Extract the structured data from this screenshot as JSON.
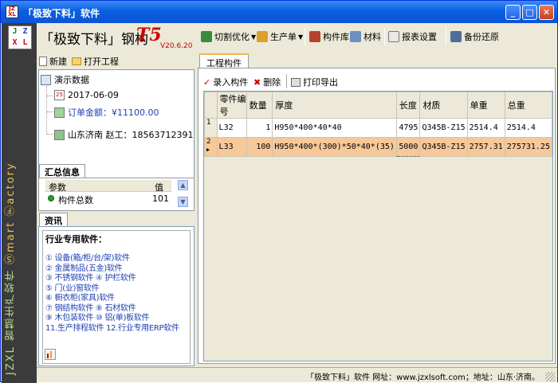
{
  "window": {
    "title": "「极致下料」软件"
  },
  "brand": {
    "name": "「极致下料」钢构",
    "t5": "T5",
    "version": "V20.6.20"
  },
  "sidebar": {
    "logo": [
      "J",
      "Z",
      "X",
      "L"
    ],
    "text1": "JZXL 智慧生产软件",
    "text2": "Ⓢmart Ⓕactory"
  },
  "toolbar": {
    "cut_optimize": "切割优化",
    "produce": "生产单",
    "component_lib": "构件库",
    "material": "材料",
    "report_settings": "报表设置",
    "backup_restore": "备份还原"
  },
  "left": {
    "new": "新建",
    "open": "打开工程",
    "tree": {
      "root": "演示数据",
      "date": "2017-06-09",
      "amount": "订单金额：¥11100.00",
      "contact": "山东济南 赵工：18563712391"
    },
    "summary": {
      "tab": "汇总信息",
      "col_param": "参数",
      "col_value": "值",
      "row_label": "构件总数",
      "row_value": "101"
    },
    "info": {
      "tab": "资讯",
      "heading": "行业专用软件：",
      "items": [
        "① 设备(箱/柜/台/架)软件",
        "② 金属制品(五金)软件",
        "③ 不锈钢软件 ④ 护栏软件",
        "⑤ 门(业)窗软件",
        "⑥ 橱衣柜(家具)软件",
        "⑦ 钢结构软件 ⑧ 石材软件",
        "⑨ 木包装软件 ⑩ 铝(单)板软件",
        "11.生产排程软件 12.行业专用ERP软件"
      ]
    }
  },
  "right": {
    "tab": "工程构件",
    "actions": {
      "add": "录入构件",
      "delete": "删除",
      "print": "打印导出"
    },
    "table": {
      "headers": [
        "",
        "零件编号",
        "数量",
        "厚度",
        "长度",
        "材质",
        "单重",
        "总重"
      ],
      "rows": [
        [
          "1",
          "L32",
          "1",
          "H950*400*40*40",
          "4795",
          "Q345B-Z15",
          "2514.4",
          "2514.4"
        ],
        [
          "2",
          "L33",
          "100",
          "H950*400*(300)*50*40*(35)",
          "5000",
          "Q345B-Z15",
          "2757.31",
          "275731.25"
        ]
      ]
    }
  },
  "status": {
    "text": "「极致下料」软件  网址：www.jzxlsoft.com；地址：山东·济南。"
  },
  "colors": {
    "titlebar": "#0a5fe0",
    "sidebar": "#3b3b3b",
    "selected_row": "#f6c89a",
    "brand_red": "#cc0000"
  }
}
